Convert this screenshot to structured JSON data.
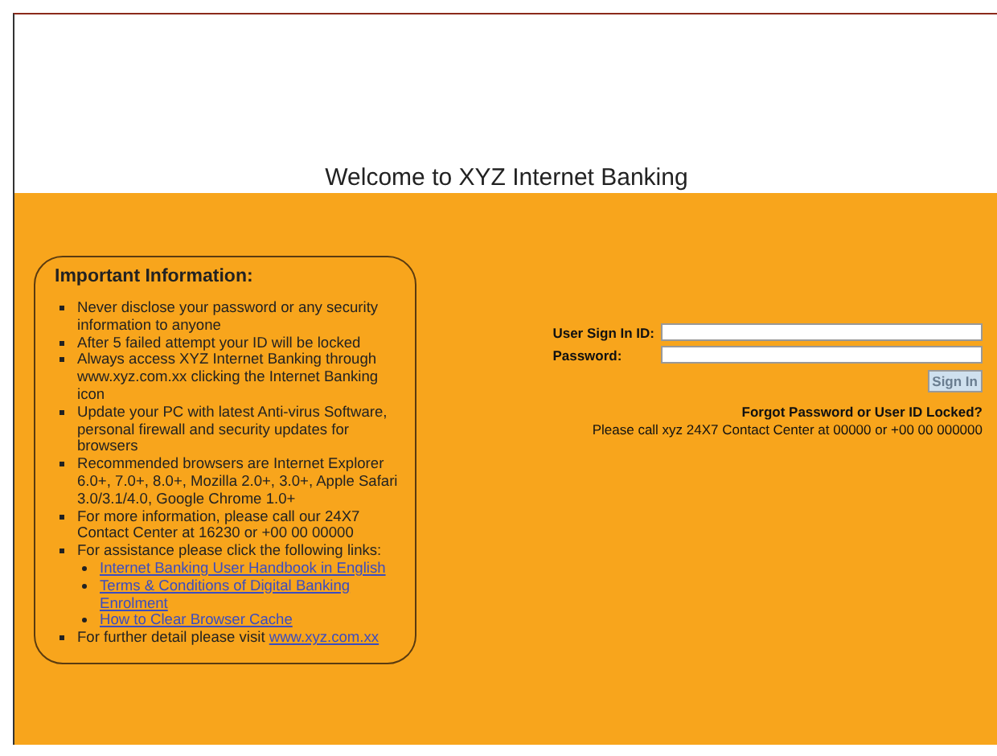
{
  "title": "Welcome to XYZ Internet Banking",
  "info": {
    "heading": "Important Information:",
    "items": [
      {
        "text": "Never disclose your password or any security information to anyone"
      },
      {
        "text": "After 5 failed attempt your ID will be locked"
      },
      {
        "text": "Always access XYZ Internet Banking through www.xyz.com.xx clicking the Internet Banking icon"
      },
      {
        "text": "Update your PC with latest Anti-virus Software, personal firewall and security updates for browsers"
      },
      {
        "text": "Recommended browsers are Internet Explorer 6.0+, 7.0+, 8.0+, Mozilla 2.0+, 3.0+, Apple Safari 3.0/3.1/4.0, Google Chrome 1.0+"
      },
      {
        "text": "For more information, please call our 24X7 Contact Center at 16230 or +00 00 00000"
      },
      {
        "text": "For assistance please click the following links:",
        "children": [
          {
            "link": "Internet Banking User Handbook in English"
          },
          {
            "link": "Terms & Conditions of Digital Banking Enrolment"
          },
          {
            "link": "How to Clear Browser Cache"
          }
        ]
      },
      {
        "text": "For further detail please visit",
        "link": "www.xyz.com.xx"
      }
    ]
  },
  "login": {
    "fields": [
      {
        "label": "User Sign In ID:"
      },
      {
        "label": "Password:"
      }
    ],
    "button": "Sign In",
    "forgot": "Forgot Password or User ID Locked?",
    "call": "Please call xyz 24X7 Contact Center at 00000 or +00 00 000000"
  }
}
